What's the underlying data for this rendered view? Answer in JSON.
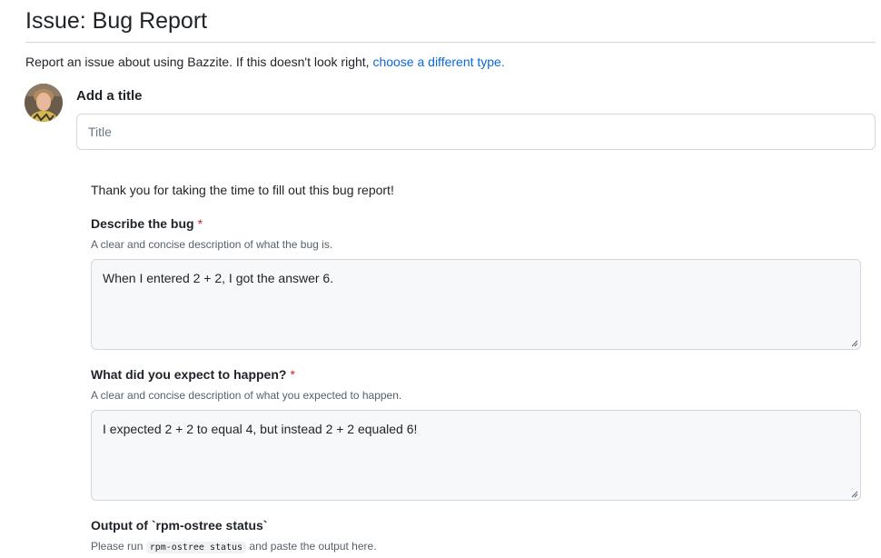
{
  "page": {
    "title": "Issue: Bug Report",
    "intro_text": "Report an issue about using Bazzite. If this doesn't look right,",
    "intro_link": "choose a different type."
  },
  "title_field": {
    "label": "Add a title",
    "placeholder": "Title",
    "value": ""
  },
  "form": {
    "thanks": "Thank you for taking the time to fill out this bug report!",
    "fields": [
      {
        "label": "Describe the bug",
        "required_mark": "*",
        "description": "A clear and concise description of what the bug is.",
        "value": "When I entered 2 + 2, I got the answer 6."
      },
      {
        "label": "What did you expect to happen?",
        "required_mark": "*",
        "description": "A clear and concise description of what you expected to happen.",
        "value": "I expected 2 + 2 to equal 4, but instead 2 + 2 equaled 6!"
      },
      {
        "label": "Output of `rpm-ostree status`",
        "description_prefix": "Please run",
        "description_code": "rpm-ostree status",
        "description_suffix": "and paste the output here."
      }
    ]
  },
  "colors": {
    "link": "#0969da",
    "required": "#cf222e",
    "border": "#d0d7de",
    "textarea_bg": "#f6f8fa"
  }
}
